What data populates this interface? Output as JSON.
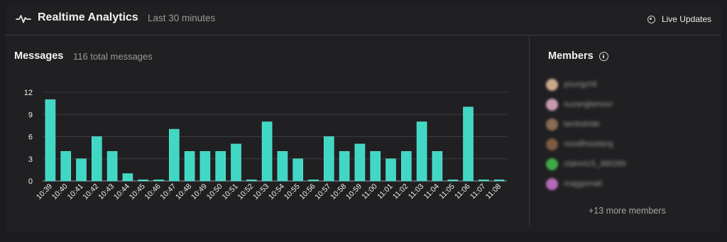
{
  "header": {
    "title": "Realtime Analytics",
    "subtitle": "Last 30 minutes",
    "live_label": "Live Updates",
    "icon": "pulse-icon"
  },
  "messages": {
    "title": "Messages",
    "count_text": "116 total messages"
  },
  "members": {
    "title": "Members",
    "items": [
      {
        "name": "youngchil",
        "avatar_color": "#c9a98a"
      },
      {
        "name": "suzanglamour",
        "avatar_color": "#c79ab0"
      },
      {
        "name": "lambstride",
        "avatar_color": "#8a6a55"
      },
      {
        "name": "noodlhoodang",
        "avatar_color": "#7a5a40"
      },
      {
        "name": "claire415_380289",
        "avatar_color": "#3faa4a"
      },
      {
        "name": "maggomali",
        "avatar_color": "#b46ab8"
      }
    ],
    "more_text": "+13 more members"
  },
  "colors": {
    "bar": "#40d8c4",
    "bar_stroke": "#64e8d6",
    "grid": "#3d3d3f",
    "axis": "#9a9a9a",
    "tick_text": "#f0f0f0"
  },
  "chart_data": {
    "type": "bar",
    "categories": [
      "10:39",
      "10:40",
      "10:41",
      "10:42",
      "10:43",
      "10:44",
      "10:45",
      "10:46",
      "10:47",
      "10:48",
      "10:49",
      "10:50",
      "10:51",
      "10:52",
      "10:53",
      "10:54",
      "10:55",
      "10:56",
      "10:57",
      "10:58",
      "10:59",
      "11:00",
      "11:01",
      "11:02",
      "11:03",
      "11:04",
      "11:05",
      "11:06",
      "11:07",
      "11:08"
    ],
    "values": [
      11,
      4,
      3,
      6,
      4,
      1,
      0,
      0,
      7,
      4,
      4,
      4,
      5,
      0,
      8,
      4,
      3,
      0,
      6,
      4,
      5,
      4,
      3,
      4,
      8,
      4,
      0,
      10,
      0,
      0
    ],
    "yticks": [
      0,
      3,
      6,
      9,
      12
    ],
    "ylim": [
      0,
      12
    ],
    "grid": true
  }
}
